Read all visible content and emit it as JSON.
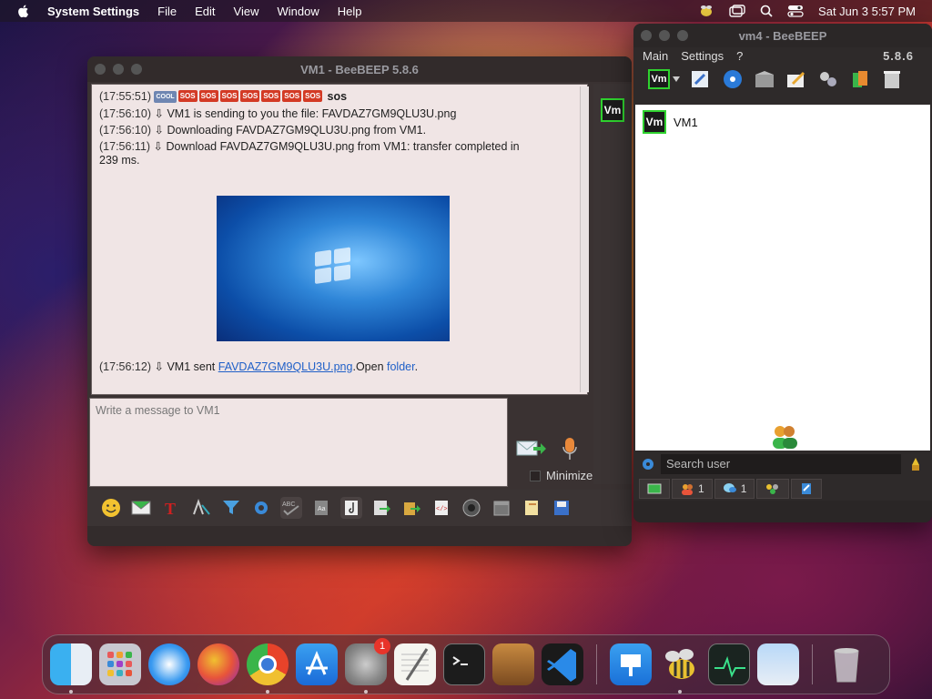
{
  "menubar": {
    "app_name": "System Settings",
    "items": [
      "File",
      "Edit",
      "View",
      "Window",
      "Help"
    ],
    "datetime": "Sat Jun 3  5:57 PM"
  },
  "vm1_window": {
    "title": "VM1 - BeeBEEP 5.8.6",
    "badge": "Vm",
    "messages": [
      {
        "time": "(17:55:51)",
        "text": "sos",
        "emoticons": [
          "COOL",
          "SOS",
          "SOS",
          "SOS",
          "SOS",
          "SOS",
          "SOS",
          "SOS"
        ]
      },
      {
        "time": "(17:56:10)",
        "text": "VM1 is sending to you the file: FAVDAZ7GM9QLU3U.png"
      },
      {
        "time": "(17:56:10)",
        "text": "Downloading FAVDAZ7GM9QLU3U.png from VM1."
      },
      {
        "time": "(17:56:11)",
        "text": "Download FAVDAZ7GM9QLU3U.png from VM1: transfer completed in",
        "text_cont": "239 ms."
      }
    ],
    "sent_msg": {
      "time": "(17:56:12)",
      "prefix": "VM1 sent ",
      "file_link": "FAVDAZ7GM9QLU3U.png",
      "middle": ".Open ",
      "folder_link": "folder",
      "suffix": "."
    },
    "input_placeholder": "Write a message to VM1",
    "minimize_label": "Minimize"
  },
  "vm4_window": {
    "title": "vm4 - BeeBEEP",
    "menu": [
      "Main",
      "Settings",
      "?"
    ],
    "version": "5.8.6",
    "user": {
      "badge": "Vm",
      "name": "VM1"
    },
    "search_placeholder": "Search user",
    "tabs": [
      {
        "icon": "users-icon",
        "count": "1"
      },
      {
        "icon": "chat-icon",
        "count": "1"
      }
    ]
  },
  "dock": {
    "settings_badge": "1"
  }
}
